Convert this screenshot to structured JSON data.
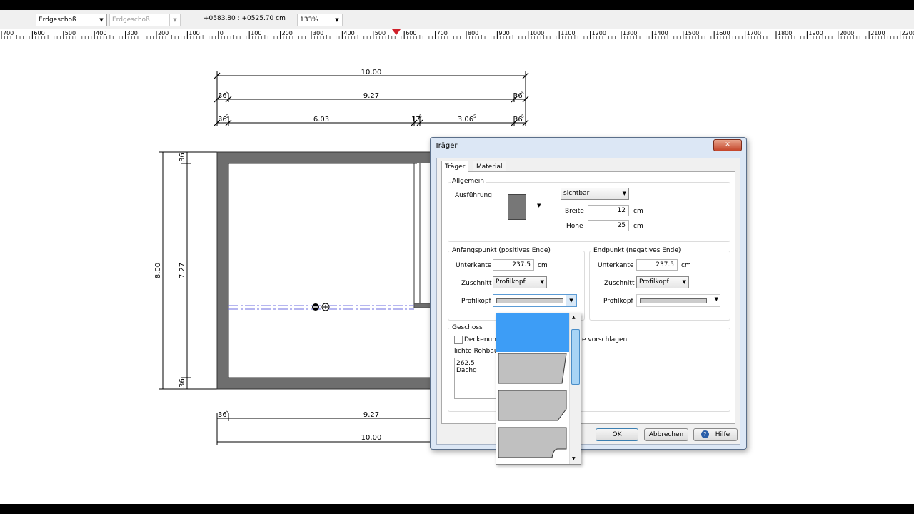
{
  "toolbar": {
    "floor_select": "Erdgeschoß",
    "floor_select2": "Erdgeschoß",
    "coords": "+0583.80 : +0525.70 cm",
    "zoom": "133%"
  },
  "ruler": {
    "labels": [
      "700",
      "600",
      "500",
      "400",
      "300",
      "200",
      "100",
      "0",
      "100",
      "200",
      "300",
      "400",
      "500",
      "600",
      "700",
      "800",
      "900",
      "1000",
      "1100",
      "1200",
      "1300",
      "1400",
      "1500",
      "1600",
      "1700",
      "1800",
      "1900",
      "2000",
      "2100",
      "2200"
    ]
  },
  "plan": {
    "dim_top_total": "10.00",
    "dim_top_inner": "9.27",
    "dim_top_a": "6.03",
    "dim_top_b": "3.06",
    "dim_top_b_sup": "5",
    "dim_top_mid": "17",
    "dim_top_mid_sup": "5",
    "dim_36": "36",
    "dim_36_sup": "5",
    "dim_bottom_inner": "9.27",
    "dim_bottom_total": "10.00",
    "dim_left_total": "8.00",
    "dim_left_inner": "7.27"
  },
  "dialog": {
    "title": "Träger",
    "close": "✕",
    "tabs": [
      "Träger",
      "Material"
    ],
    "allgemein": {
      "label": "Allgemein",
      "ausfuehrung": "Ausführung",
      "visibility": "sichtbar",
      "breite_label": "Breite",
      "breite_value": "12",
      "hoehe_label": "Höhe",
      "hoehe_value": "25",
      "unit": "cm"
    },
    "anfang": {
      "label": "Anfangspunkt (positives Ende)",
      "unterkante_label": "Unterkante",
      "unterkante_value": "237.5",
      "unit": "cm",
      "zuschnitt_label": "Zuschnitt",
      "zuschnitt_value": "Profilkopf",
      "profilkopf_label": "Profilkopf"
    },
    "ende": {
      "label": "Endpunkt (negatives Ende)",
      "unterkante_label": "Unterkante",
      "unterkante_value": "237.5",
      "unit": "cm",
      "zuschnitt_label": "Zuschnitt",
      "zuschnitt_value": "Profilkopf",
      "profilkopf_label": "Profilkopf"
    },
    "geschoss": {
      "label": "Geschoss",
      "checkbox_label": "Deckenunt",
      "checkbox_suffix": "e vorschlagen",
      "lichte_label": "lichte Rohbau",
      "textarea_value": "262.5 Dachg"
    },
    "buttons": {
      "ok": "OK",
      "cancel": "Abbrechen",
      "help": "Hilfe"
    }
  }
}
